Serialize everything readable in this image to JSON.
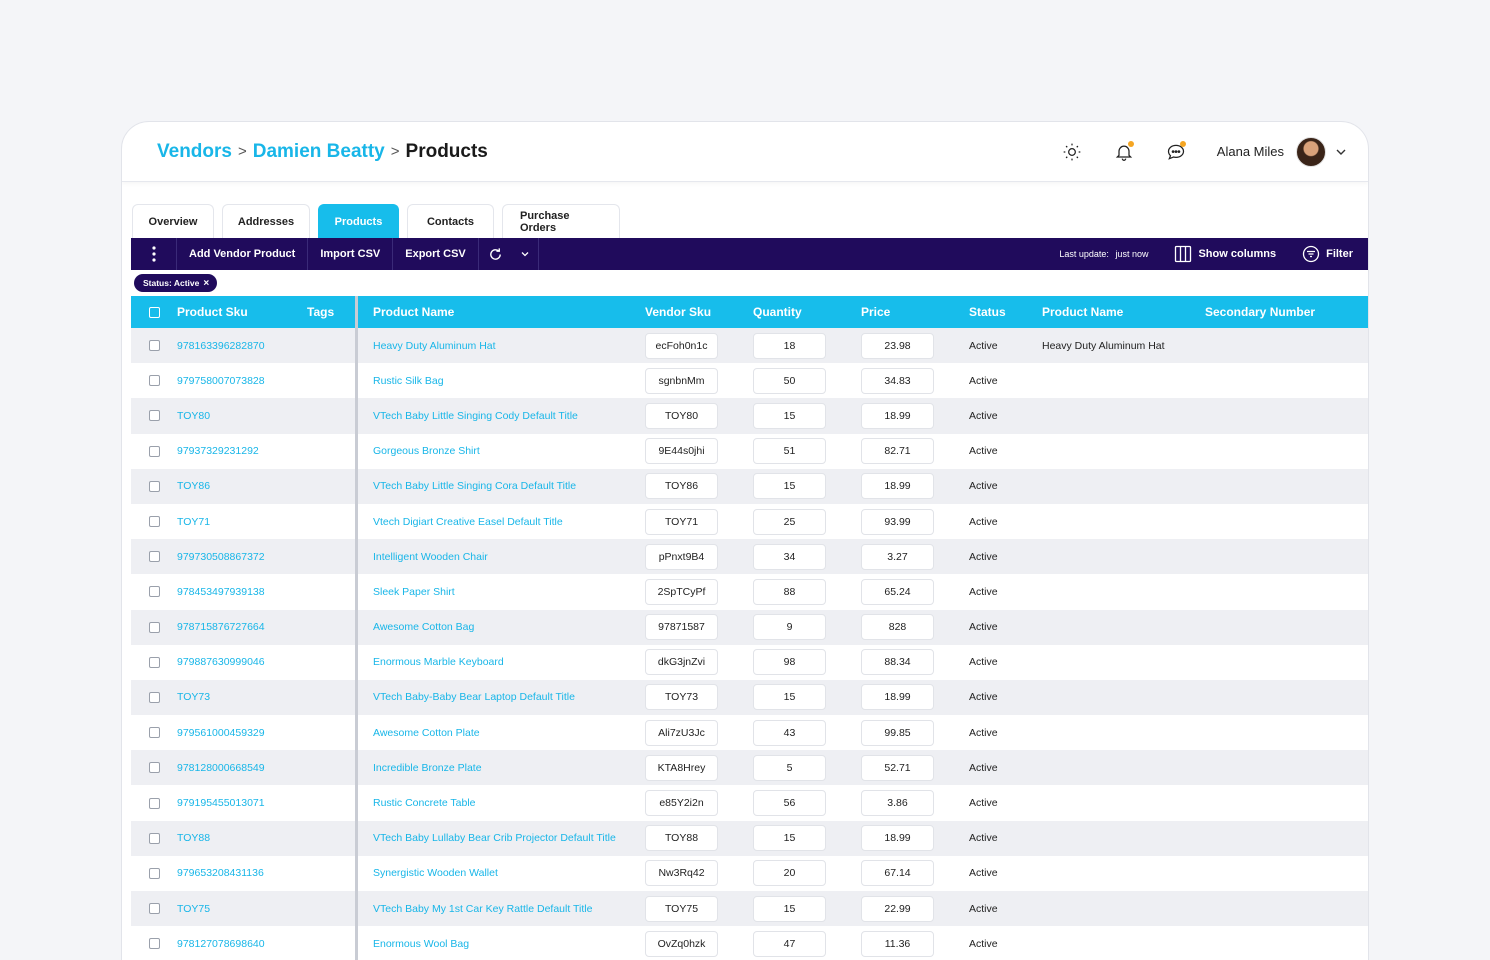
{
  "breadcrumb": {
    "items": [
      "Vendors",
      "Damien Beatty"
    ],
    "current": "Products"
  },
  "user": {
    "name": "Alana Miles"
  },
  "tabs": [
    {
      "label": "Overview"
    },
    {
      "label": "Addresses"
    },
    {
      "label": "Products",
      "active": true
    },
    {
      "label": "Contacts"
    },
    {
      "label": "Purchase Orders"
    }
  ],
  "toolbar": {
    "add_label": "Add Vendor Product",
    "import_label": "Import CSV",
    "export_label": "Export CSV",
    "last_update_label": "Last update:",
    "last_update_value": "just now",
    "show_columns_label": "Show columns",
    "filter_label": "Filter"
  },
  "filter_chip": {
    "label": "Status: Active"
  },
  "columns": {
    "sku": "Product Sku",
    "tags": "Tags",
    "product_name": "Product Name",
    "vendor_sku": "Vendor Sku",
    "quantity": "Quantity",
    "price": "Price",
    "status": "Status",
    "product_name_2": "Product Name",
    "secondary_number": "Secondary Number"
  },
  "rows": [
    {
      "sku": "978163396282870",
      "name": "Heavy Duty Aluminum Hat",
      "vsku": "ecFoh0n1c",
      "qty": "18",
      "price": "23.98",
      "status": "Active",
      "name2": "Heavy Duty Aluminum Hat"
    },
    {
      "sku": "979758007073828",
      "name": "Rustic Silk Bag",
      "vsku": "sgnbnMm",
      "qty": "50",
      "price": "34.83",
      "status": "Active",
      "name2": ""
    },
    {
      "sku": "TOY80",
      "name": "VTech Baby Little Singing Cody Default Title",
      "vsku": "TOY80",
      "qty": "15",
      "price": "18.99",
      "status": "Active",
      "name2": ""
    },
    {
      "sku": "97937329231292",
      "name": "Gorgeous Bronze Shirt",
      "vsku": "9E44s0jhi",
      "qty": "51",
      "price": "82.71",
      "status": "Active",
      "name2": ""
    },
    {
      "sku": "TOY86",
      "name": "VTech Baby Little Singing Cora Default Title",
      "vsku": "TOY86",
      "qty": "15",
      "price": "18.99",
      "status": "Active",
      "name2": ""
    },
    {
      "sku": "TOY71",
      "name": "Vtech Digiart Creative Easel Default Title",
      "vsku": "TOY71",
      "qty": "25",
      "price": "93.99",
      "status": "Active",
      "name2": ""
    },
    {
      "sku": "979730508867372",
      "name": "Intelligent Wooden Chair",
      "vsku": "pPnxt9B4",
      "qty": "34",
      "price": "3.27",
      "status": "Active",
      "name2": ""
    },
    {
      "sku": "978453497939138",
      "name": "Sleek Paper Shirt",
      "vsku": "2SpTCyPf",
      "qty": "88",
      "price": "65.24",
      "status": "Active",
      "name2": ""
    },
    {
      "sku": "978715876727664",
      "name": "Awesome Cotton Bag",
      "vsku": "97871587",
      "qty": "9",
      "price": "828",
      "status": "Active",
      "name2": ""
    },
    {
      "sku": "979887630999046",
      "name": "Enormous Marble Keyboard",
      "vsku": "dkG3jnZvi",
      "qty": "98",
      "price": "88.34",
      "status": "Active",
      "name2": ""
    },
    {
      "sku": "TOY73",
      "name": "VTech Baby-Baby Bear Laptop Default Title",
      "vsku": "TOY73",
      "qty": "15",
      "price": "18.99",
      "status": "Active",
      "name2": ""
    },
    {
      "sku": "979561000459329",
      "name": "Awesome Cotton Plate",
      "vsku": "Ali7zU3Jc",
      "qty": "43",
      "price": "99.85",
      "status": "Active",
      "name2": ""
    },
    {
      "sku": "978128000668549",
      "name": "Incredible Bronze Plate",
      "vsku": "KTA8Hrey",
      "qty": "5",
      "price": "52.71",
      "status": "Active",
      "name2": ""
    },
    {
      "sku": "979195455013071",
      "name": "Rustic Concrete Table",
      "vsku": "e85Y2i2n",
      "qty": "56",
      "price": "3.86",
      "status": "Active",
      "name2": ""
    },
    {
      "sku": "TOY88",
      "name": "VTech Baby Lullaby Bear Crib Projector Default Title",
      "vsku": "TOY88",
      "qty": "15",
      "price": "18.99",
      "status": "Active",
      "name2": ""
    },
    {
      "sku": "979653208431136",
      "name": "Synergistic Wooden Wallet",
      "vsku": "Nw3Rq42",
      "qty": "20",
      "price": "67.14",
      "status": "Active",
      "name2": ""
    },
    {
      "sku": "TOY75",
      "name": "VTech Baby My 1st Car Key Rattle Default Title",
      "vsku": "TOY75",
      "qty": "15",
      "price": "22.99",
      "status": "Active",
      "name2": ""
    },
    {
      "sku": "978127078698640",
      "name": "Enormous Wool Bag",
      "vsku": "OvZq0hzk",
      "qty": "47",
      "price": "11.36",
      "status": "Active",
      "name2": ""
    }
  ],
  "colors": {
    "accent": "#17bdeb",
    "toolbar": "#200b5c",
    "link": "#18b6e8",
    "notification_dot": "#f5a623"
  },
  "icons": [
    "sun-icon",
    "bell-icon",
    "chat-icon",
    "chevron-down-icon",
    "kebab-icon",
    "refresh-icon",
    "columns-icon",
    "filter-icon",
    "close-icon"
  ]
}
